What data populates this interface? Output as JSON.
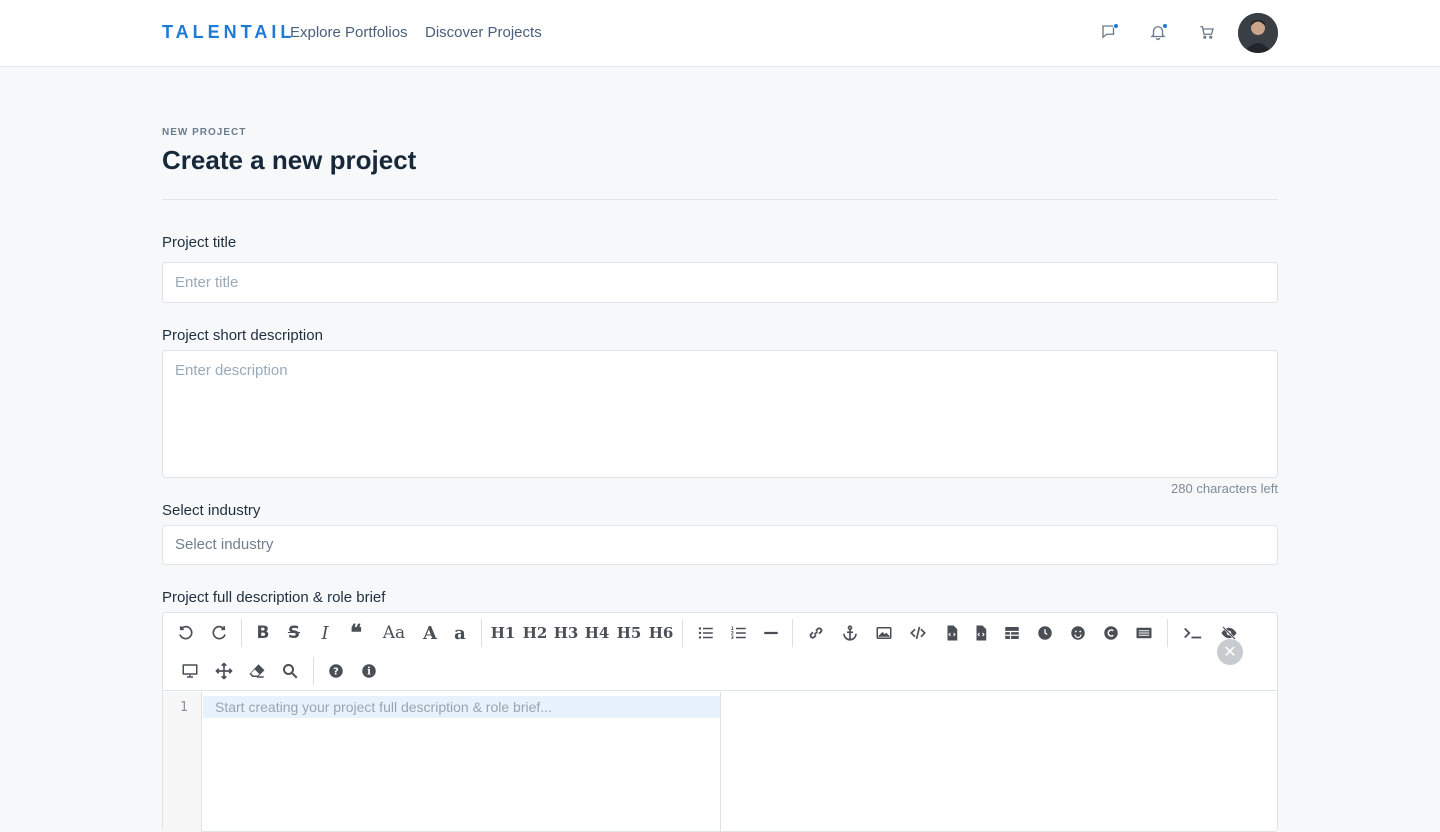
{
  "header": {
    "logo": "TALENTAIL",
    "nav": [
      "Explore Portfolios",
      "Discover Projects"
    ],
    "icons": [
      "chat-icon",
      "bell-icon",
      "cart-icon"
    ],
    "accent": "#1f7ad6"
  },
  "page": {
    "overline": "NEW PROJECT",
    "title": "Create a new project"
  },
  "form": {
    "title_label": "Project title",
    "title_placeholder": "Enter title",
    "short_label": "Project short description",
    "short_placeholder": "Enter description",
    "counter": "280 characters left",
    "industry_label": "Select industry",
    "industry_value": "Select industry",
    "full_label": "Project full description & role brief"
  },
  "editor": {
    "toolbar_text": {
      "h1": "H1",
      "h2": "H2",
      "h3": "H3",
      "h4": "H4",
      "h5": "H5",
      "h6": "H6",
      "bold": "B",
      "strike": "S",
      "italic": "I",
      "quote": "❝",
      "case": "Aa",
      "upper": "A",
      "lower": "a"
    },
    "line_number": "1",
    "placeholder": "Start creating your project full description & role brief..."
  }
}
